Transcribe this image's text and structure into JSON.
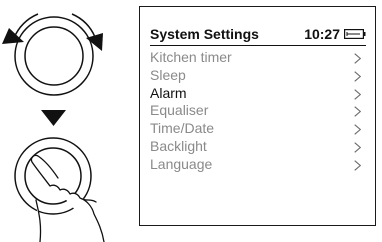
{
  "screen": {
    "title": "System Settings",
    "time": "10:27",
    "battery": "battery-icon",
    "selected_index": 2,
    "items": [
      {
        "label": "Kitchen timer"
      },
      {
        "label": "Sleep"
      },
      {
        "label": "Alarm"
      },
      {
        "label": "Equaliser"
      },
      {
        "label": "Time/Date"
      },
      {
        "label": "Backlight"
      },
      {
        "label": "Language"
      }
    ]
  },
  "illustration": {
    "top": "rotate-knob-icon",
    "middle": "down-triangle-icon",
    "bottom": "press-knob-icon"
  }
}
